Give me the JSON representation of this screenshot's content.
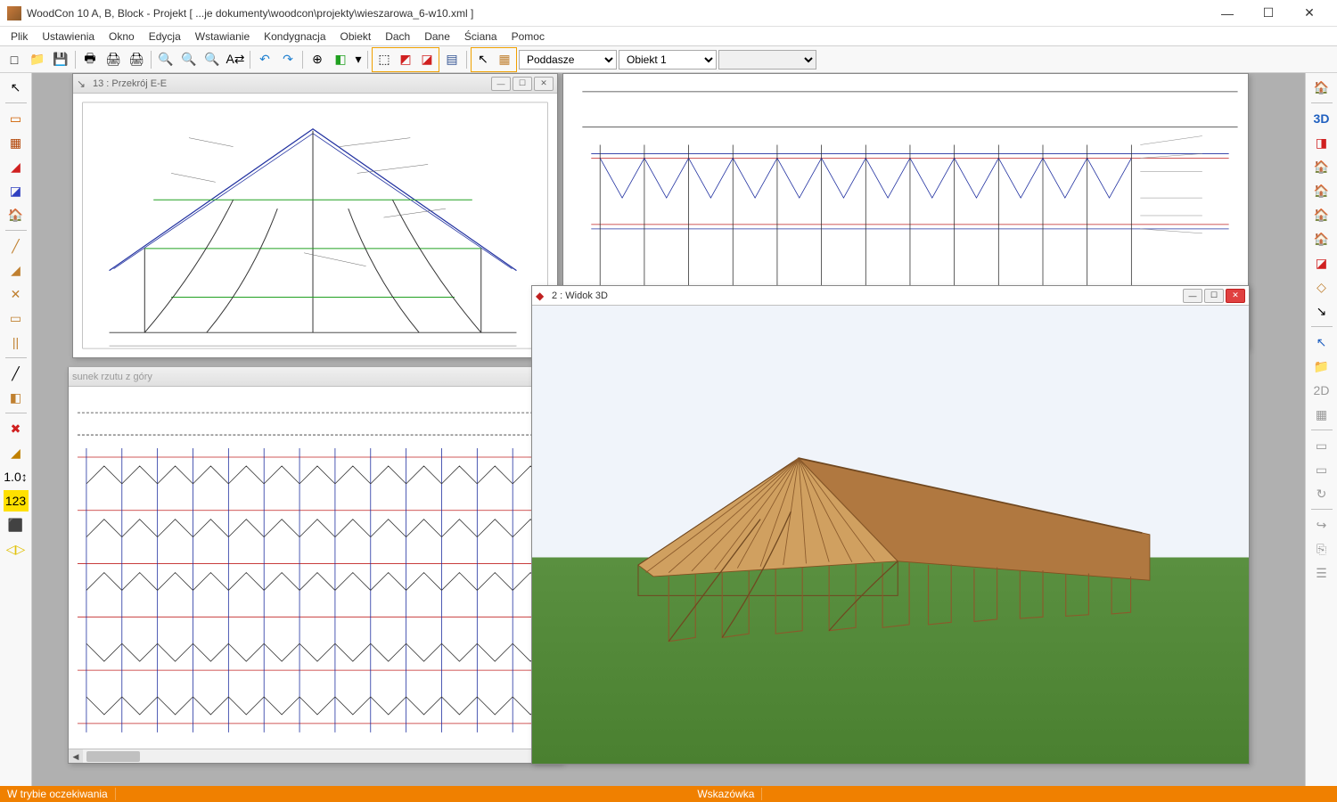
{
  "title": "WoodCon 10 A, B, Block - Projekt [ ...je dokumenty\\woodcon\\projekty\\wieszarowa_6-w10.xml ]",
  "menu": [
    "Plik",
    "Ustawienia",
    "Okno",
    "Edycja",
    "Wstawianie",
    "Kondygnacja",
    "Obiekt",
    "Dach",
    "Dane",
    "Ściana",
    "Pomoc"
  ],
  "toolbar_icons": {
    "new": "□",
    "open": "📁",
    "save": "💾",
    "save2": "🖶",
    "print": "🖨",
    "print2": "🖨",
    "zoom_in": "🔍",
    "zoom_out": "🔍",
    "zoom_fit": "🔍",
    "dims": "A⇄",
    "undo": "↶",
    "redo": "↷",
    "origin": "⊕",
    "cube": "◧",
    "dd": "▾",
    "panel_a": "⬚",
    "panel_b": "◩",
    "panel_c": "◪",
    "hatch": "▤",
    "cursor": "↖",
    "stock": "▦"
  },
  "toolbar_dropdowns": {
    "level": "Poddasze",
    "object": "Obiekt 1",
    "extra": ""
  },
  "left_tools": [
    "↖",
    "▭",
    "▦",
    "◢",
    "◪",
    "🏠",
    "╱",
    "◢",
    "✕",
    "▭",
    "||",
    "╱",
    "◧",
    "✖",
    "◢",
    "1.0↕",
    "123",
    "⬛",
    "◁▷"
  ],
  "right_tools": [
    "🏠",
    "3D",
    "◨",
    "🏠",
    "🏠",
    "🏠",
    "🏠",
    "◪",
    "◇",
    "↘",
    "↖",
    "📁",
    "2D",
    "▦",
    "▭",
    "▭",
    "↻",
    "↪",
    "⎘",
    "☰"
  ],
  "windows": {
    "section": {
      "title": "13 : Przekrój E-E"
    },
    "plan_hint": "sunek rzutu z góry",
    "view3d": {
      "title": "2 : Widok 3D"
    }
  },
  "status": {
    "left": "W trybie oczekiwania",
    "mid": "Wskazówka"
  }
}
